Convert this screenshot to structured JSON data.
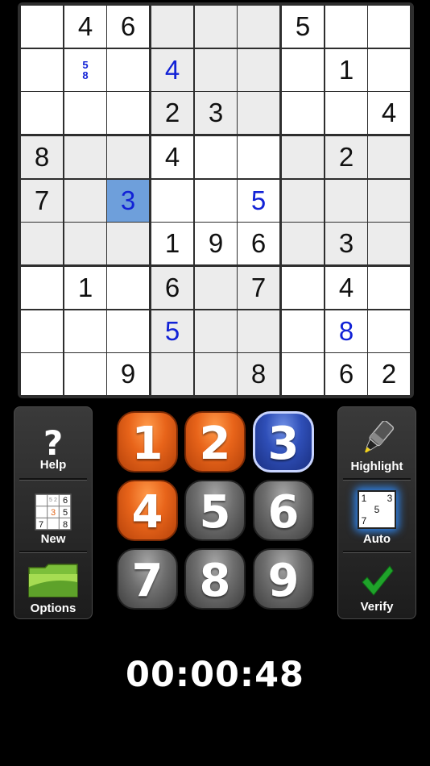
{
  "board": {
    "rows": [
      [
        "",
        "4",
        "6",
        "",
        "",
        "",
        "5",
        "",
        ""
      ],
      [
        "",
        "",
        "",
        "4",
        "",
        "",
        "",
        "1",
        ""
      ],
      [
        "",
        "",
        "",
        "2",
        "3",
        "",
        "",
        "",
        "4"
      ],
      [
        "8",
        "",
        "",
        "4",
        "",
        "",
        "",
        "2",
        ""
      ],
      [
        "7",
        "",
        "3",
        "",
        "",
        "5",
        "",
        "",
        ""
      ],
      [
        "",
        "",
        "",
        "1",
        "9",
        "6",
        "",
        "3",
        ""
      ],
      [
        "",
        "1",
        "",
        "6",
        "",
        "7",
        "",
        "4",
        ""
      ],
      [
        "",
        "",
        "",
        "5",
        "",
        "",
        "",
        "8",
        ""
      ],
      [
        "",
        "",
        "9",
        "",
        "",
        "8",
        "",
        "6",
        "2"
      ]
    ],
    "user_entries": [
      [
        1,
        3
      ],
      [
        4,
        2
      ],
      [
        4,
        5
      ],
      [
        7,
        3
      ],
      [
        7,
        7
      ]
    ],
    "notes": [
      {
        "row": 1,
        "col": 1,
        "values": [
          "5",
          "8"
        ]
      }
    ],
    "selected": {
      "row": 4,
      "col": 2
    }
  },
  "left_panel": {
    "help_label": "Help",
    "help_icon": "question-mark-icon",
    "new_label": "New",
    "new_icon": "mini-sudoku-grid-icon",
    "new_icon_digits": [
      "5",
      "2",
      "6",
      "3",
      "5",
      "7",
      "8"
    ],
    "options_label": "Options",
    "options_icon": "green-folder-icon"
  },
  "number_pad": [
    {
      "digit": "1",
      "style": "orange"
    },
    {
      "digit": "2",
      "style": "orange"
    },
    {
      "digit": "3",
      "style": "blue"
    },
    {
      "digit": "4",
      "style": "orange"
    },
    {
      "digit": "5",
      "style": "gray"
    },
    {
      "digit": "6",
      "style": "gray"
    },
    {
      "digit": "7",
      "style": "gray"
    },
    {
      "digit": "8",
      "style": "gray"
    },
    {
      "digit": "9",
      "style": "gray"
    }
  ],
  "right_panel": {
    "highlight_label": "Highlight",
    "highlight_icon": "highlighter-marker-icon",
    "auto_label": "Auto",
    "auto_icon": "auto-notes-grid-icon",
    "auto_icon_digits": [
      "1",
      "3",
      "5",
      "7"
    ],
    "verify_label": "Verify",
    "verify_icon": "green-checkmark-icon"
  },
  "timer": "00:00:48",
  "colors": {
    "user_digit": "#1222d6",
    "selected_cell": "#6e9fdb",
    "shaded_box": "#ececec",
    "orange_button": "#e8641a",
    "gray_button": "#6e6e6e",
    "blue_button": "#2f4fb8"
  }
}
